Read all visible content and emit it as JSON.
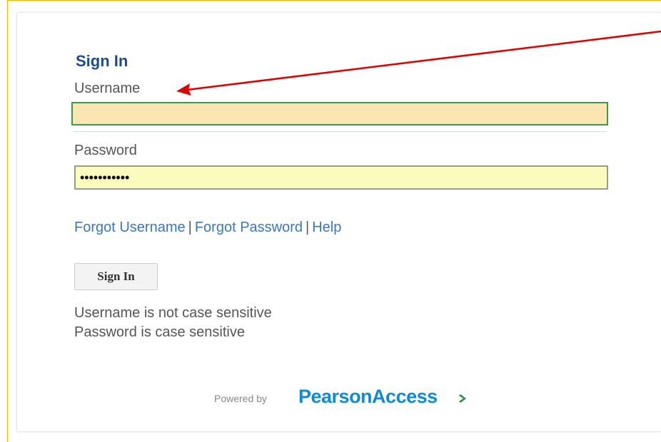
{
  "signin": {
    "title": "Sign In",
    "username_label": "Username",
    "username_value": "",
    "password_label": "Password",
    "password_value": "•••••••••••",
    "links": {
      "forgot_username": "Forgot Username",
      "separator": "|",
      "forgot_password": "Forgot Password",
      "help": "Help"
    },
    "button_label": "Sign In",
    "notes": {
      "username_note": "Username is not case sensitive",
      "password_note": "Password is case sensitive"
    }
  },
  "footer": {
    "powered_by": "Powered by",
    "brand": "PearsonAccess",
    "brand_icon": "chevron-right-icon"
  },
  "annotation": {
    "type": "arrow",
    "color": "#e00000",
    "points_to": "username-label"
  },
  "colors": {
    "title": "#1c4c8c",
    "link": "#3b77b6",
    "username_field_bg": "#fbe5b2",
    "username_field_border": "#3c9a47",
    "password_field_bg": "#fbfbbd",
    "brand": "#0f8bd1",
    "brand_chevron": "#2e8b3d",
    "frame_border": "#f2b705"
  }
}
